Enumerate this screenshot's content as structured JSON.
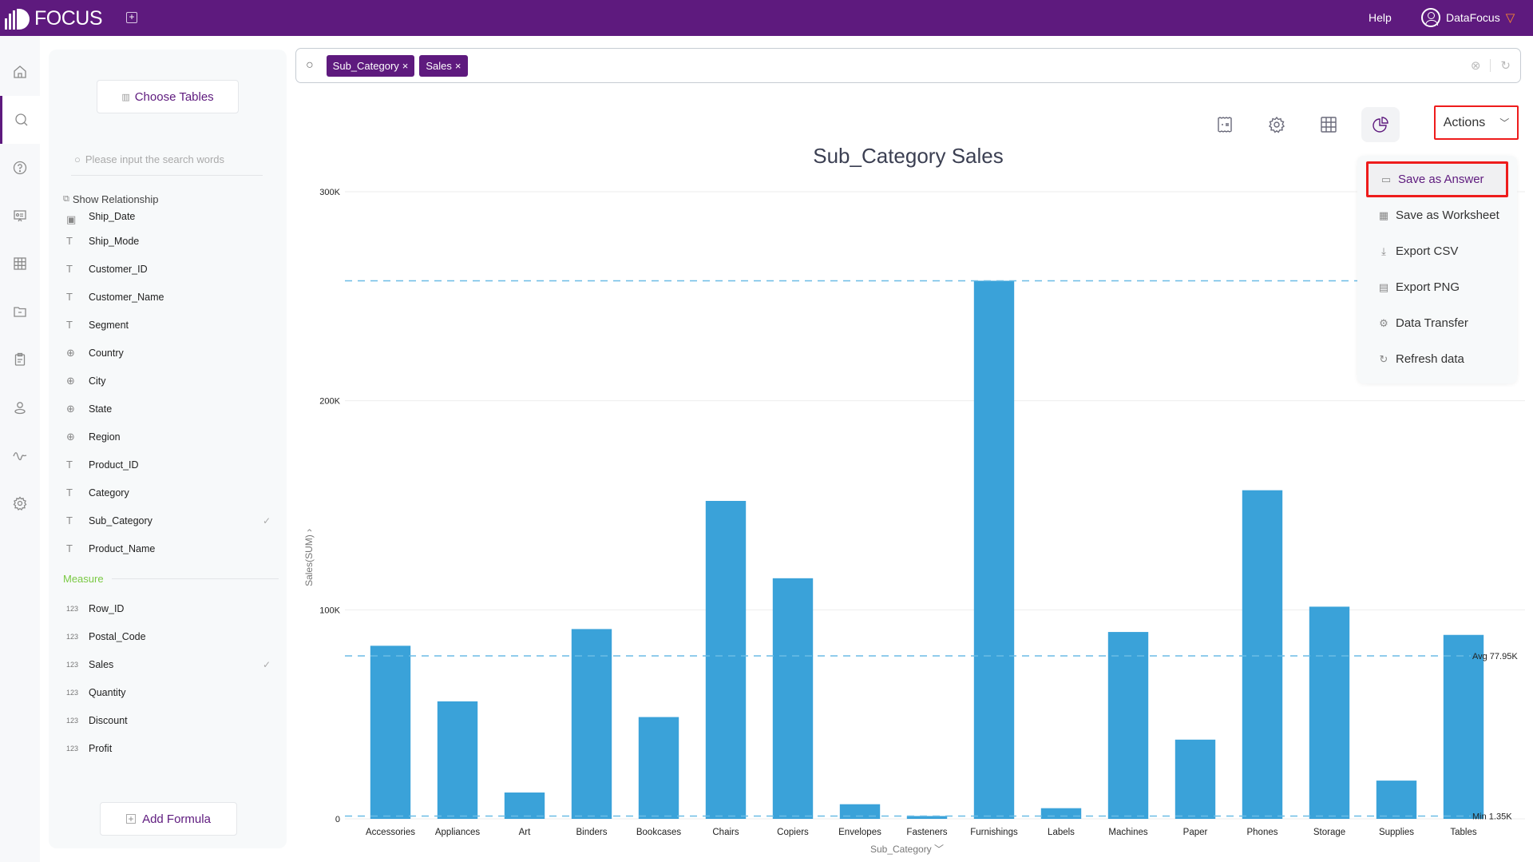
{
  "app": {
    "logo_text": "FOCUS",
    "help_label": "Help",
    "user_name": "DataFocus",
    "brand_color": "#5e1a7e"
  },
  "left_nav": [
    {
      "icon": "home-icon",
      "active": false
    },
    {
      "icon": "search-icon",
      "active": true
    },
    {
      "icon": "question-icon",
      "active": false
    },
    {
      "icon": "presentation-icon",
      "active": false
    },
    {
      "icon": "table-icon",
      "active": false
    },
    {
      "icon": "folder-icon",
      "active": false
    },
    {
      "icon": "clipboard-icon",
      "active": false
    },
    {
      "icon": "user-icon",
      "active": false
    },
    {
      "icon": "pulse-icon",
      "active": false
    },
    {
      "icon": "gear-icon",
      "active": false
    }
  ],
  "panel": {
    "choose_tables_label": "Choose Tables",
    "search_placeholder": "Please input the search words",
    "show_relationship_label": "Show Relationship",
    "attributes": [
      {
        "name": "Ship_Date",
        "type": "date",
        "checked": false
      },
      {
        "name": "Ship_Mode",
        "type": "text",
        "checked": false
      },
      {
        "name": "Customer_ID",
        "type": "text",
        "checked": false
      },
      {
        "name": "Customer_Name",
        "type": "text",
        "checked": false
      },
      {
        "name": "Segment",
        "type": "text",
        "checked": false
      },
      {
        "name": "Country",
        "type": "geo",
        "checked": false
      },
      {
        "name": "City",
        "type": "geo",
        "checked": false
      },
      {
        "name": "State",
        "type": "geo",
        "checked": false
      },
      {
        "name": "Region",
        "type": "geo",
        "checked": false
      },
      {
        "name": "Product_ID",
        "type": "text",
        "checked": false
      },
      {
        "name": "Category",
        "type": "text",
        "checked": false
      },
      {
        "name": "Sub_Category",
        "type": "text",
        "checked": true
      },
      {
        "name": "Product_Name",
        "type": "text",
        "checked": false
      }
    ],
    "measure_heading": "Measure",
    "measures": [
      {
        "name": "Row_ID",
        "checked": false
      },
      {
        "name": "Postal_Code",
        "checked": false
      },
      {
        "name": "Sales",
        "checked": true
      },
      {
        "name": "Quantity",
        "checked": false
      },
      {
        "name": "Discount",
        "checked": false
      },
      {
        "name": "Profit",
        "checked": false
      }
    ],
    "type_icon_number": "123",
    "add_formula_label": "Add Formula"
  },
  "search": {
    "chips": [
      {
        "label": "Sub_Category"
      },
      {
        "label": "Sales"
      }
    ]
  },
  "toolbar": {
    "actions_label": "Actions"
  },
  "actions_menu": [
    {
      "label": "Save as Answer",
      "icon": "save-icon",
      "highlighted": true
    },
    {
      "label": "Save as Worksheet",
      "icon": "table-icon",
      "highlighted": false
    },
    {
      "label": "Export CSV",
      "icon": "download-icon",
      "highlighted": false
    },
    {
      "label": "Export PNG",
      "icon": "png-file-icon",
      "highlighted": false
    },
    {
      "label": "Data Transfer",
      "icon": "gear-icon",
      "highlighted": false
    },
    {
      "label": "Refresh data",
      "icon": "refresh-icon",
      "highlighted": false
    }
  ],
  "chart_data": {
    "type": "bar",
    "title": "Sub_Category Sales",
    "xlabel": "Sub_Category",
    "ylabel": "Sales(SUM)",
    "ylim": [
      0,
      300000
    ],
    "yticks": [
      0,
      100000,
      200000,
      300000
    ],
    "ytick_labels": [
      "0",
      "100K",
      "200K",
      "300K"
    ],
    "grid": true,
    "bar_color": "#3aa2d9",
    "categories": [
      "Accessories",
      "Appliances",
      "Art",
      "Binders",
      "Bookcases",
      "Chairs",
      "Copiers",
      "Envelopes",
      "Fasteners",
      "Furnishings",
      "Labels",
      "Machines",
      "Paper",
      "Phones",
      "Storage",
      "Supplies",
      "Tables"
    ],
    "values": [
      82800,
      56200,
      12600,
      90800,
      48700,
      152100,
      115100,
      7000,
      1350,
      257400,
      5100,
      89400,
      37900,
      157200,
      101500,
      18300,
      88000
    ],
    "reference_lines": [
      {
        "name": "Max",
        "value": 257400,
        "label": ""
      },
      {
        "name": "Avg",
        "value": 77950,
        "label": "Avg 77.95K"
      },
      {
        "name": "Min",
        "value": 1350,
        "label": "Min 1.35K"
      }
    ]
  }
}
